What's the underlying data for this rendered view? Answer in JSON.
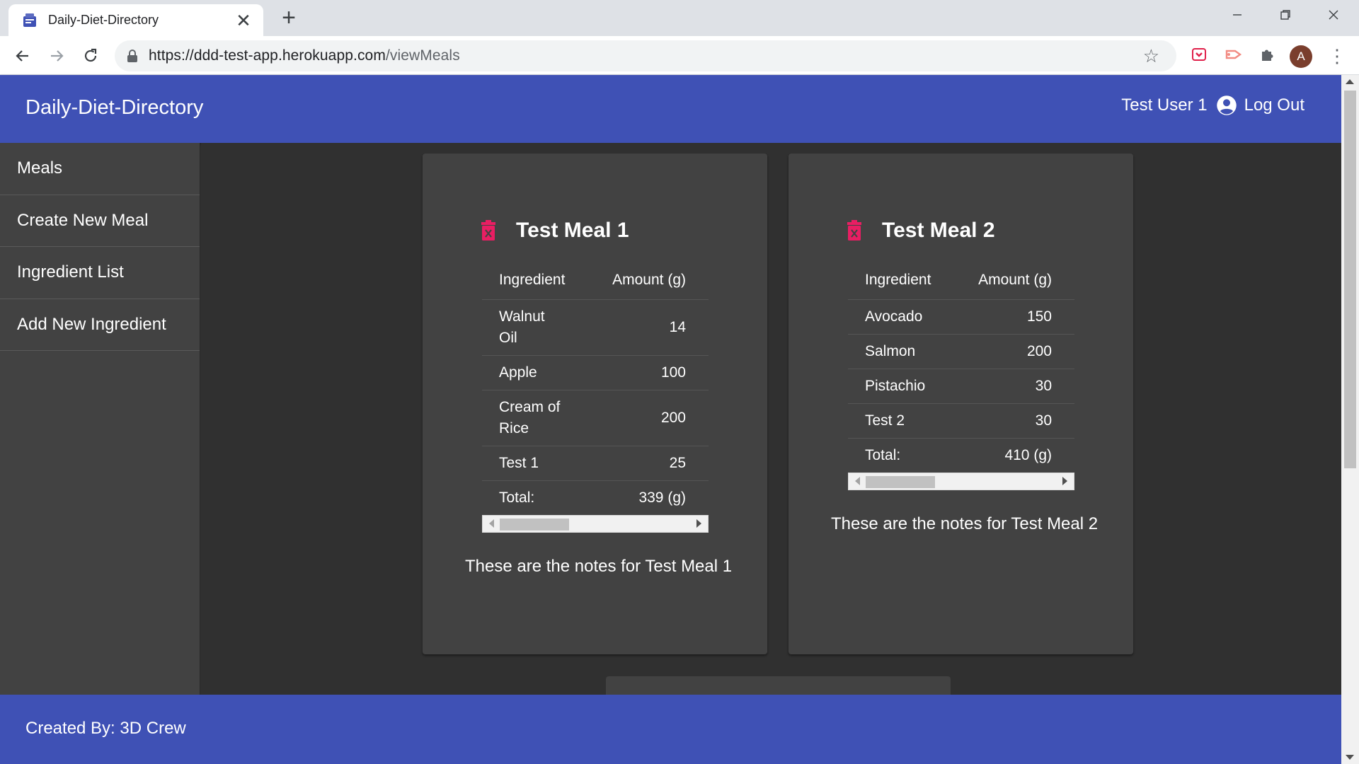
{
  "browser": {
    "tab_title": "Daily-Diet-Directory",
    "tab_close": "✕",
    "new_tab": "+",
    "url_host": "https://ddd-test-app.herokuapp.com",
    "url_path": "/viewMeals",
    "window_controls": [
      "minimize-icon",
      "restore-icon",
      "close-icon"
    ],
    "profile_initial": "A"
  },
  "header": {
    "brand": "Daily-Diet-Directory",
    "user_name": "Test User 1",
    "logout_label": "Log Out"
  },
  "sidebar": {
    "items": [
      {
        "label": "Meals"
      },
      {
        "label": "Create New Meal"
      },
      {
        "label": "Ingredient List"
      },
      {
        "label": "Add New Ingredient"
      }
    ]
  },
  "meals": [
    {
      "title": "Test Meal 1",
      "col_ingredient": "Ingredient",
      "col_amount": "Amount (g)",
      "rows": [
        {
          "name": "Walnut Oil",
          "amount": "14"
        },
        {
          "name": "Apple",
          "amount": "100"
        },
        {
          "name": "Cream of Rice",
          "amount": "200"
        },
        {
          "name": "Test 1",
          "amount": "25"
        }
      ],
      "total_label": "Total:",
      "total_value": "339 (g)",
      "notes": "These are the notes for Test Meal 1"
    },
    {
      "title": "Test Meal 2",
      "col_ingredient": "Ingredient",
      "col_amount": "Amount (g)",
      "rows": [
        {
          "name": "Avocado",
          "amount": "150"
        },
        {
          "name": "Salmon",
          "amount": "200"
        },
        {
          "name": "Pistachio",
          "amount": "30"
        },
        {
          "name": "Test 2",
          "amount": "30"
        }
      ],
      "total_label": "Total:",
      "total_value": "410 (g)",
      "notes": "These are the notes for Test Meal 2"
    }
  ],
  "footer": {
    "text": "Created By: 3D Crew"
  },
  "colors": {
    "primary": "#3f51b5",
    "background": "#303030",
    "card": "#424242",
    "delete_icon": "#e91e63"
  }
}
